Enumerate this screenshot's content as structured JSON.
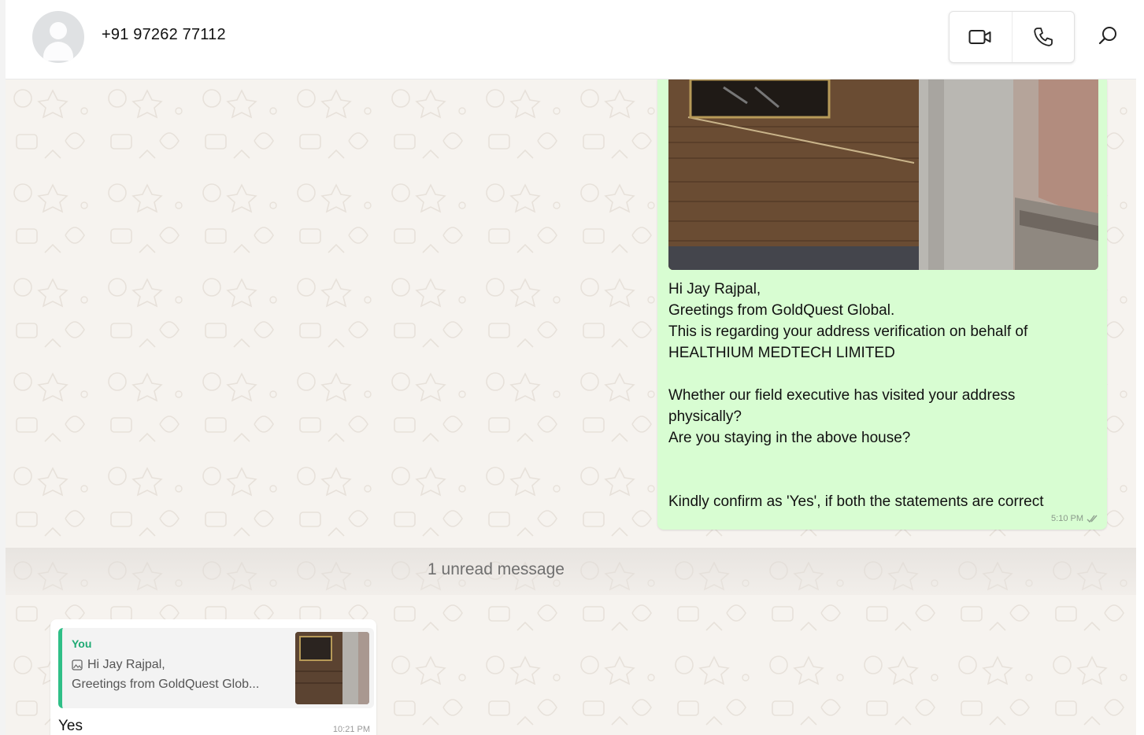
{
  "header": {
    "contact_name": "+91 97262 77112",
    "icons": {
      "avatar": "person-placeholder-icon",
      "video": "video-call-icon",
      "voice": "phone-icon",
      "search": "search-icon"
    }
  },
  "chat": {
    "outgoing": {
      "lines": [
        "Hi Jay Rajpal,",
        "Greetings from GoldQuest Global.",
        "This is regarding your address verification on behalf of",
        "HEALTHIUM MEDTECH LIMITED",
        "",
        "Whether our field executive has visited your address",
        "physically?",
        "Are you staying in the above house?",
        "",
        "",
        "Kindly confirm as 'Yes', if both the statements are correct"
      ],
      "time": "5:10 PM",
      "status_icon": "double-tick-icon"
    },
    "unread_label": "1 unread message",
    "incoming": {
      "quote_author": "You",
      "quote_line1": "Hi Jay Rajpal,",
      "quote_line2": "Greetings from GoldQuest Glob...",
      "quote_icon": "image-icon",
      "text": "Yes",
      "time": "10:21 PM"
    }
  },
  "colors": {
    "outgoing_bubble": "#d8fdd2",
    "chat_background": "#f6f3ef",
    "quote_accent": "#2fbf87"
  }
}
